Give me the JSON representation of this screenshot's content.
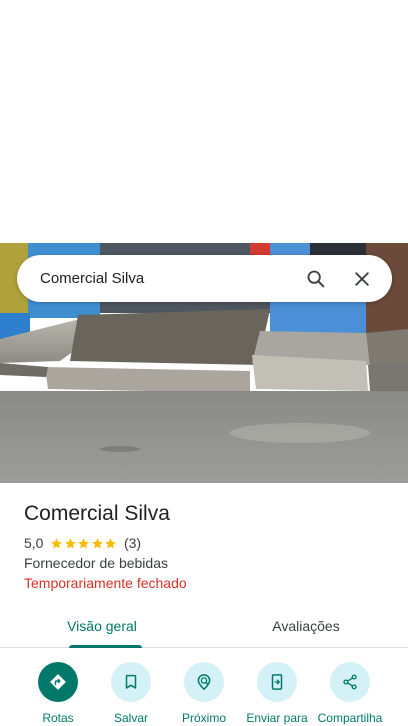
{
  "search": {
    "query": "Comercial Silva"
  },
  "place": {
    "title": "Comercial Silva",
    "rating": "5,0",
    "stars": 5,
    "review_count": "(3)",
    "category": "Fornecedor de bebidas",
    "status": "Temporariamente fechado",
    "status_color": "#d93025"
  },
  "tabs": [
    {
      "label": "Visão geral",
      "active": true
    },
    {
      "label": "Avaliações",
      "active": false
    }
  ],
  "actions": [
    {
      "label": "Rotas",
      "icon": "directions-icon"
    },
    {
      "label": "Salvar",
      "icon": "bookmark-icon"
    },
    {
      "label": "Próximo",
      "icon": "nearby-icon"
    },
    {
      "label": "Enviar para",
      "icon": "send-to-phone-icon"
    },
    {
      "label": "Compartilha",
      "icon": "share-icon"
    }
  ],
  "colors": {
    "accent": "#00796b",
    "action_bg": "#d3f1f7",
    "star": "#fbbc04"
  }
}
